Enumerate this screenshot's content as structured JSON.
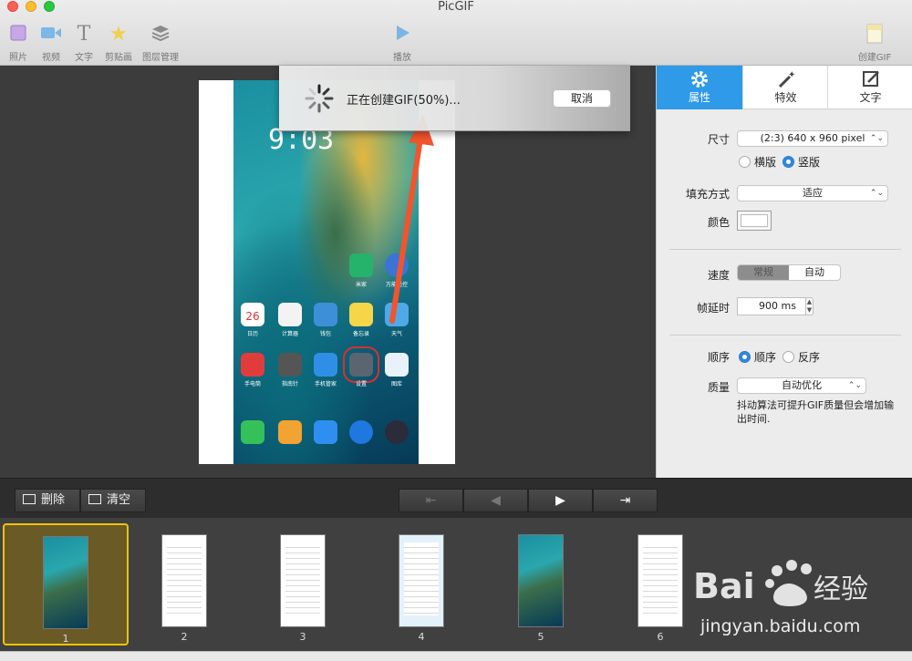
{
  "window": {
    "title": "PicGIF"
  },
  "toolbar": {
    "items": [
      {
        "label": "照片",
        "icon": "photo-icon"
      },
      {
        "label": "视频",
        "icon": "video-icon"
      },
      {
        "label": "文字",
        "icon": "text-icon"
      },
      {
        "label": "剪贴画",
        "icon": "star-icon"
      },
      {
        "label": "图层管理",
        "icon": "layers-icon"
      }
    ],
    "play_label": "播放",
    "create_label": "创建GIF"
  },
  "preview": {
    "clock": "9:03",
    "app_labels": [
      "米家",
      "万能遥控",
      "日历",
      "计算器",
      "钱包",
      "备忘录",
      "天气",
      "手电筒",
      "指南针",
      "手机管家",
      "设置",
      "图库"
    ],
    "calendar_day": "26"
  },
  "progress": {
    "message": "正在创建GIF(50%)...",
    "cancel_label": "取消",
    "percent": 50
  },
  "inspector": {
    "tabs": [
      {
        "label": "属性",
        "icon": "gear-icon"
      },
      {
        "label": "特效",
        "icon": "magic-wand-icon"
      },
      {
        "label": "文字",
        "icon": "edit-icon"
      }
    ],
    "size": {
      "label": "尺寸",
      "value": "(2:3) 640 x 960 pixel"
    },
    "orientation": {
      "landscape": "横版",
      "portrait": "竖版",
      "selected": "portrait"
    },
    "fill": {
      "label": "填充方式",
      "value": "适应"
    },
    "color": {
      "label": "颜色",
      "value": "#ffffff"
    },
    "speed": {
      "label": "速度",
      "options": [
        "常规",
        "自动"
      ],
      "selected": "常规"
    },
    "delay": {
      "label": "帧延时",
      "value": "900 ms"
    },
    "order": {
      "label": "顺序",
      "forward": "顺序",
      "reverse": "反序",
      "selected": "forward"
    },
    "quality": {
      "label": "质量",
      "value": "自动优化"
    },
    "hint": "抖动算法可提升GIF质量但会增加输出时间."
  },
  "controls": {
    "delete_label": "删除",
    "clear_label": "清空",
    "nav": [
      {
        "name": "first-frame-icon",
        "glyph": "⇤"
      },
      {
        "name": "prev-frame-icon",
        "glyph": "◀"
      },
      {
        "name": "next-frame-icon",
        "glyph": "▶"
      },
      {
        "name": "last-frame-icon",
        "glyph": "⇥"
      }
    ]
  },
  "frames": [
    {
      "number": "1",
      "kind": "wall",
      "selected": true
    },
    {
      "number": "2",
      "kind": "doc"
    },
    {
      "number": "3",
      "kind": "doc"
    },
    {
      "number": "4",
      "kind": "doc"
    },
    {
      "number": "5",
      "kind": "wall"
    },
    {
      "number": "6",
      "kind": "doc"
    }
  ],
  "watermark": {
    "brand": "Bai度经验",
    "url": "jingyan.baidu.com"
  },
  "colors": {
    "accent": "#2e9ae8",
    "selection": "#f2c400",
    "arrow": "#f2542d"
  }
}
